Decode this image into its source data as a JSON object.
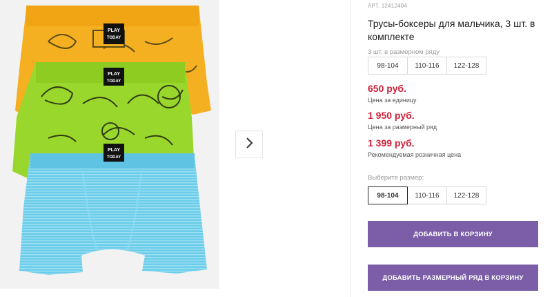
{
  "product": {
    "article": "АРТ. 12412404",
    "title": "Трусы-боксеры для мальчика, 3 шт. в комплекте"
  },
  "gallery": {
    "brand_tag_line1": "PLAY",
    "brand_tag_line2": "TODAY",
    "colors": {
      "yellow": "#f5b021",
      "green": "#9ad72c",
      "blue": "#6ccdea"
    },
    "next_icon": "chevron-right-icon"
  },
  "set_sizes": {
    "hint": "3 шт. в размерном ряду",
    "options": [
      "98-104",
      "110-116",
      "122-128"
    ]
  },
  "prices": {
    "unit_price": "650 руб.",
    "unit_note": "Цена за единицу",
    "set_price": "1 950 руб.",
    "set_note": "Цена за размерный ряд",
    "retail_price": "1 399 руб.",
    "retail_note": "Рекомендуемая розничная цена",
    "price_color": "#d0203a"
  },
  "size_select": {
    "label": "Выберите размер:",
    "options": [
      "98-104",
      "110-116",
      "122-128"
    ],
    "selected": "98-104"
  },
  "actions": {
    "add_to_cart": "ДОБАВИТЬ В КОРЗИНУ",
    "add_set_to_cart": "ДОБАВИТЬ РАЗМЕРНЫЙ РЯД В КОРЗИНУ",
    "button_color": "#7b5ea7"
  }
}
